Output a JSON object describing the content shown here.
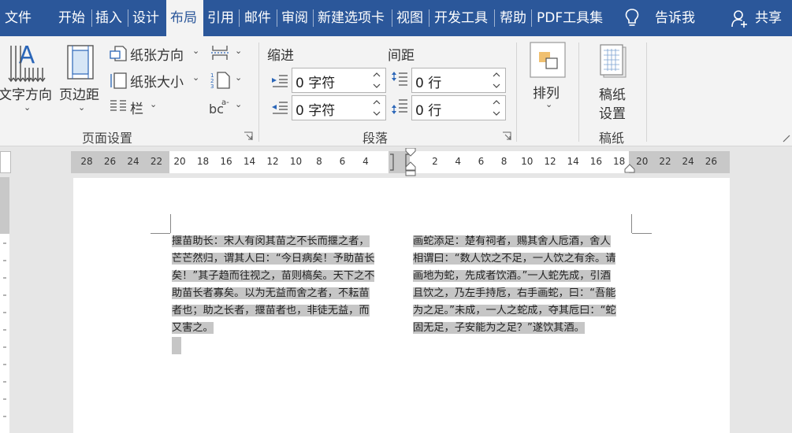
{
  "tabs": [
    "文件",
    "开始",
    "插入",
    "设计",
    "布局",
    "引用",
    "邮件",
    "审阅",
    "新建选项卡",
    "视图",
    "开发工具",
    "帮助",
    "PDF工具集"
  ],
  "active_tab": "布局",
  "tell_me": "告诉我",
  "share": "共享",
  "page_setup": {
    "text_direction": "文字方向",
    "margins": "页边距",
    "orientation": "纸张方向",
    "size": "纸张大小",
    "columns": "栏",
    "group_label": "页面设置"
  },
  "paragraph": {
    "indent_label": "缩进",
    "spacing_label": "间距",
    "indent_left": "0 字符",
    "indent_right": "0 字符",
    "spacing_before": "0 行",
    "spacing_after": "0 行",
    "group_label": "段落"
  },
  "arrange": {
    "label": "排列"
  },
  "manuscript": {
    "line1": "稿纸",
    "line2": "设置",
    "group_label": "稿纸"
  },
  "ruler": {
    "left_numbers": [
      "28",
      "26",
      "24",
      "22",
      "20",
      "18",
      "16",
      "14",
      "12",
      "10",
      "8",
      "6",
      "4"
    ],
    "right_numbers": [
      "2",
      "4",
      "6",
      "8",
      "10",
      "12",
      "14",
      "16",
      "18",
      "20",
      "22",
      "24",
      "26"
    ]
  },
  "doc": {
    "col1": [
      "揠苗助长：宋人有闵其苗之不长而揠之者，",
      "芒芒然归，谓其人曰：“今日病矣！予助苗长",
      "矣！”其子趋而往视之，苗则槁矣。天下之不",
      "助苗长者寡矣。以为无益而舍之者，不耘苗",
      "者也；助之长者，揠苗者也，非徒无益，而",
      "又害之。"
    ],
    "col2": [
      "画蛇添足：楚有祠者，赐其舍人卮酒，舍人",
      "相谓曰：“数人饮之不足，一人饮之有余。请",
      "画地为蛇，先成者饮酒。”一人蛇先成，引酒",
      "且饮之，乃左手持卮，右手画蛇，曰：“吾能",
      "为之足。”未成，一人之蛇成，夺其卮曰：“蛇",
      "固无足，子安能为之足？”遂饮其酒。"
    ]
  }
}
